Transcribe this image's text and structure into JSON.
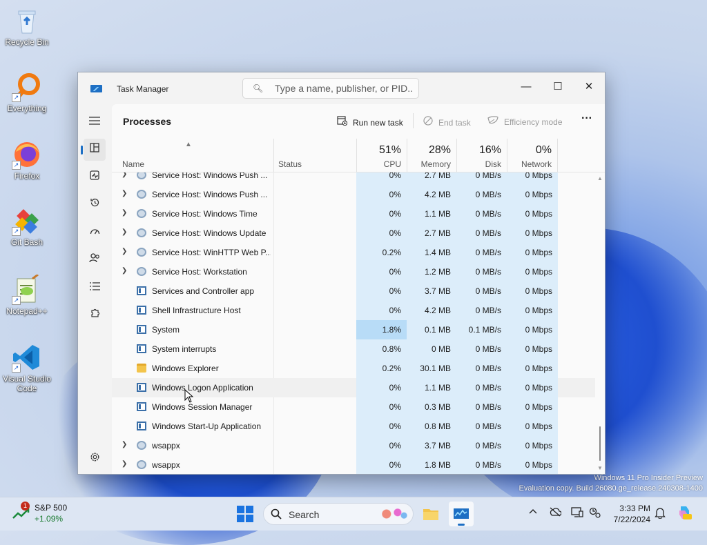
{
  "desktop": {
    "icons": [
      {
        "label": "Recycle Bin"
      },
      {
        "label": "Everything"
      },
      {
        "label": "Firefox"
      },
      {
        "label": "Git Bash"
      },
      {
        "label": "Notepad++"
      },
      {
        "label": "Visual Studio Code"
      }
    ],
    "watermark": {
      "line1": "Windows 11 Pro Insider Preview",
      "line2": "Evaluation copy. Build 26080.ge_release.240308-1400"
    }
  },
  "window": {
    "title": "Task Manager",
    "search_placeholder": "Type a name, publisher, or PID...",
    "controls": {
      "minimize": "—",
      "maximize": "☐",
      "close": "✕"
    }
  },
  "sidebar": {
    "items": [
      {
        "name": "menu",
        "icon": "hamburger-icon"
      },
      {
        "name": "processes",
        "icon": "processes-icon",
        "active": true
      },
      {
        "name": "performance",
        "icon": "performance-icon"
      },
      {
        "name": "app-history",
        "icon": "history-icon"
      },
      {
        "name": "startup-apps",
        "icon": "speedometer-icon"
      },
      {
        "name": "users",
        "icon": "users-icon"
      },
      {
        "name": "details",
        "icon": "list-icon"
      },
      {
        "name": "services",
        "icon": "puzzle-icon"
      },
      {
        "name": "settings",
        "icon": "gear-icon"
      }
    ]
  },
  "toolbar": {
    "page_title": "Processes",
    "run_new_task": "Run new task",
    "end_task": "End task",
    "efficiency_mode": "Efficiency mode",
    "more": "···"
  },
  "table": {
    "headers": {
      "name": "Name",
      "status": "Status",
      "cpu_pct": "51%",
      "cpu": "CPU",
      "mem_pct": "28%",
      "mem": "Memory",
      "disk_pct": "16%",
      "disk": "Disk",
      "net_pct": "0%",
      "net": "Network"
    },
    "rows": [
      {
        "name": "Service Host: Windows Push ...",
        "icon": "gear",
        "expandable": true,
        "cpu": "0%",
        "mem": "2.7 MB",
        "disk": "0 MB/s",
        "net": "0 Mbps"
      },
      {
        "name": "Service Host: Windows Push ...",
        "icon": "gear",
        "expandable": true,
        "cpu": "0%",
        "mem": "4.2 MB",
        "disk": "0 MB/s",
        "net": "0 Mbps"
      },
      {
        "name": "Service Host: Windows Time",
        "icon": "gear",
        "expandable": true,
        "cpu": "0%",
        "mem": "1.1 MB",
        "disk": "0 MB/s",
        "net": "0 Mbps"
      },
      {
        "name": "Service Host: Windows Update",
        "icon": "gear",
        "expandable": true,
        "cpu": "0%",
        "mem": "2.7 MB",
        "disk": "0 MB/s",
        "net": "0 Mbps"
      },
      {
        "name": "Service Host: WinHTTP Web P...",
        "icon": "gear",
        "expandable": true,
        "cpu": "0.2%",
        "mem": "1.4 MB",
        "disk": "0 MB/s",
        "net": "0 Mbps"
      },
      {
        "name": "Service Host: Workstation",
        "icon": "gear",
        "expandable": true,
        "cpu": "0%",
        "mem": "1.2 MB",
        "disk": "0 MB/s",
        "net": "0 Mbps"
      },
      {
        "name": "Services and Controller app",
        "icon": "window",
        "expandable": false,
        "cpu": "0%",
        "mem": "3.7 MB",
        "disk": "0 MB/s",
        "net": "0 Mbps"
      },
      {
        "name": "Shell Infrastructure Host",
        "icon": "window",
        "expandable": false,
        "cpu": "0%",
        "mem": "4.2 MB",
        "disk": "0 MB/s",
        "net": "0 Mbps"
      },
      {
        "name": "System",
        "icon": "window",
        "expandable": false,
        "cpu": "1.8%",
        "mem": "0.1 MB",
        "disk": "0.1 MB/s",
        "net": "0 Mbps",
        "hot": true
      },
      {
        "name": "System interrupts",
        "icon": "window",
        "expandable": false,
        "cpu": "0.8%",
        "mem": "0 MB",
        "disk": "0 MB/s",
        "net": "0 Mbps"
      },
      {
        "name": "Windows Explorer",
        "icon": "folder",
        "expandable": false,
        "cpu": "0.2%",
        "mem": "30.1 MB",
        "disk": "0 MB/s",
        "net": "0 Mbps"
      },
      {
        "name": "Windows Logon Application",
        "icon": "window",
        "expandable": false,
        "cpu": "0%",
        "mem": "1.1 MB",
        "disk": "0 MB/s",
        "net": "0 Mbps",
        "hover": true
      },
      {
        "name": "Windows Session Manager",
        "icon": "window",
        "expandable": false,
        "cpu": "0%",
        "mem": "0.3 MB",
        "disk": "0 MB/s",
        "net": "0 Mbps"
      },
      {
        "name": "Windows Start-Up Application",
        "icon": "window",
        "expandable": false,
        "cpu": "0%",
        "mem": "0.8 MB",
        "disk": "0 MB/s",
        "net": "0 Mbps"
      },
      {
        "name": "wsappx",
        "icon": "gear",
        "expandable": true,
        "cpu": "0%",
        "mem": "3.7 MB",
        "disk": "0 MB/s",
        "net": "0 Mbps"
      },
      {
        "name": "wsappx",
        "icon": "gear",
        "expandable": true,
        "cpu": "0%",
        "mem": "1.8 MB",
        "disk": "0 MB/s",
        "net": "0 Mbps"
      }
    ]
  },
  "taskbar": {
    "widget": {
      "badge": "1",
      "title": "S&P 500",
      "change": "+1.09%"
    },
    "search_label": "Search",
    "clock": {
      "time": "3:33 PM",
      "date": "7/22/2024"
    },
    "colors": {
      "accent": "#1d6fc4",
      "selection": "#dcedfa",
      "positive": "#1a7a30"
    }
  }
}
